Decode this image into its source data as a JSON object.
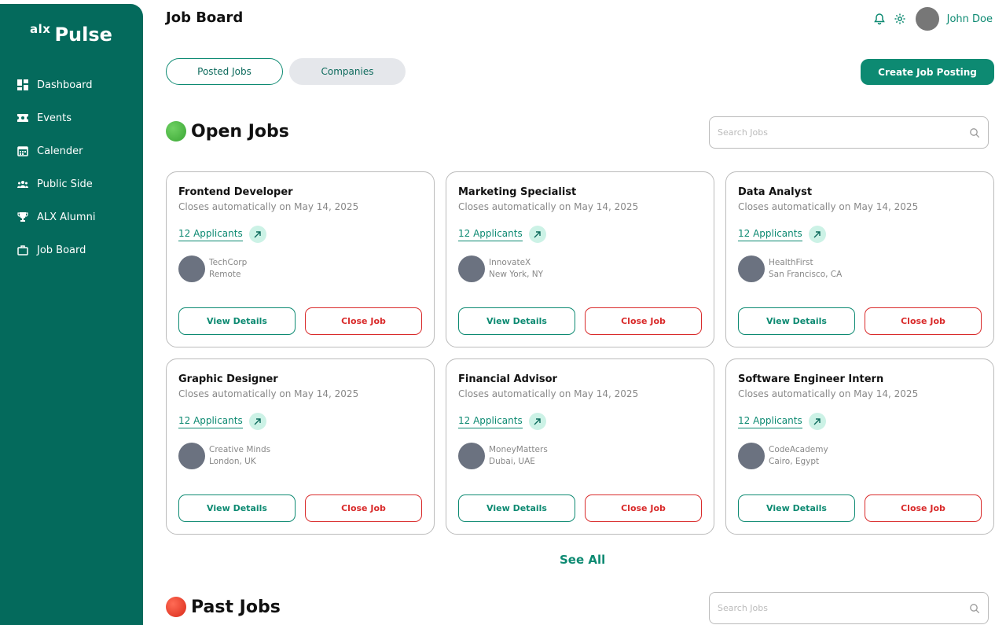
{
  "brand": {
    "prefix": "alx",
    "name": "Pulse"
  },
  "sidebar": {
    "items": [
      {
        "label": "Dashboard",
        "icon": "dashboard-icon"
      },
      {
        "label": "Events",
        "icon": "ticket-icon"
      },
      {
        "label": "Calender",
        "icon": "calendar-icon"
      },
      {
        "label": "Public Side",
        "icon": "people-icon"
      },
      {
        "label": "ALX Alumni",
        "icon": "trophy-icon"
      },
      {
        "label": "Job Board",
        "icon": "briefcase-icon"
      }
    ]
  },
  "header": {
    "title": "Job Board",
    "user_name": "John Doe"
  },
  "tabs": [
    {
      "label": "Posted Jobs"
    },
    {
      "label": "Companies"
    }
  ],
  "create_button": "Create Job Posting",
  "open_jobs": {
    "title": "Open Jobs",
    "search_placeholder": "Search Jobs",
    "cards": [
      {
        "title": "Frontend Developer",
        "closes": "Closes automatically on May 14, 2025",
        "applicants": "12 Applicants",
        "company": "TechCorp",
        "location": "Remote",
        "view": "View Details",
        "close": "Close Job"
      },
      {
        "title": "Marketing Specialist",
        "closes": "Closes automatically on May 14, 2025",
        "applicants": "12 Applicants",
        "company": "InnovateX",
        "location": "New York, NY",
        "view": "View Details",
        "close": "Close Job"
      },
      {
        "title": "Data Analyst",
        "closes": "Closes automatically on May 14, 2025",
        "applicants": "12 Applicants",
        "company": "HealthFirst",
        "location": "San Francisco, CA",
        "view": "View Details",
        "close": "Close Job"
      },
      {
        "title": "Graphic Designer",
        "closes": "Closes automatically on May 14, 2025",
        "applicants": "12 Applicants",
        "company": "Creative Minds",
        "location": "London, UK",
        "view": "View Details",
        "close": "Close Job"
      },
      {
        "title": "Financial Advisor",
        "closes": "Closes automatically on May 14, 2025",
        "applicants": "12 Applicants",
        "company": "MoneyMatters",
        "location": "Dubai, UAE",
        "view": "View Details",
        "close": "Close Job"
      },
      {
        "title": "Software Engineer Intern",
        "closes": "Closes automatically on May 14, 2025",
        "applicants": "12 Applicants",
        "company": "CodeAcademy",
        "location": "Cairo, Egypt",
        "view": "View Details",
        "close": "Close Job"
      }
    ],
    "see_all": "See All"
  },
  "past_jobs": {
    "title": "Past Jobs",
    "search_placeholder": "Search Jobs"
  },
  "colors": {
    "primary": "#046a5c",
    "accent": "#0d8a72",
    "danger": "#d92b2b"
  }
}
